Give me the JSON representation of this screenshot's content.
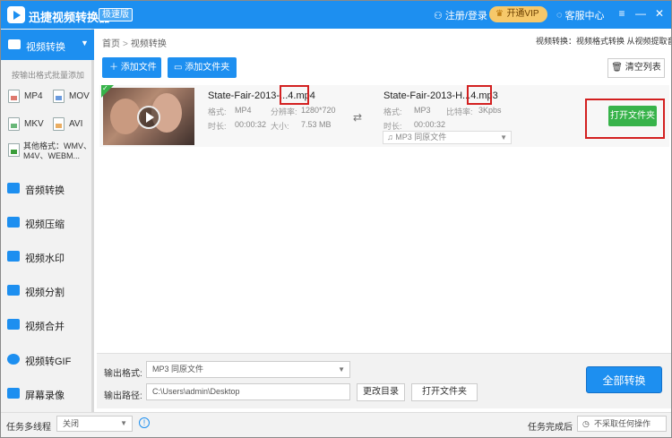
{
  "titlebar": {
    "app_title": "迅捷视频转换器",
    "edition_badge": "极速版",
    "login_label": "注册/登录",
    "vip_label": "开通VIP",
    "service_label": "客服中心"
  },
  "sidebar": {
    "active_item": "视频转换",
    "format_hint": "按输出格式批量添加",
    "formats": [
      "MP4",
      "MOV",
      "MKV",
      "AVI"
    ],
    "other_formats": "其他格式：WMV、M4V、WEBM...",
    "items": [
      "音频转换",
      "视频压缩",
      "视频水印",
      "视频分割",
      "视频合并",
      "视频转GIF",
      "屏幕录像"
    ]
  },
  "breadcrumb": {
    "home": "首页",
    "separator": ">",
    "current": "视频转换"
  },
  "header_hint": "视频转换：视频格式转换 从视频提取音频",
  "toolbar": {
    "add_file": "添加文件",
    "add_folder": "添加文件夹",
    "clear_list": "清空列表"
  },
  "file_row": {
    "source": {
      "name_prefix": "State-Fair-2013-...",
      "name_ext": "4.mp4",
      "format_label": "格式:",
      "format_value": "MP4",
      "resolution_label": "分辨率:",
      "resolution_value": "1280*720",
      "duration_label": "时长:",
      "duration_value": "00:00:32",
      "size_label": "大小:",
      "size_value": "7.53 MB"
    },
    "output": {
      "name_prefix": "State-Fair-2013-H...",
      "name_ext": "4.mp3",
      "format_label": "格式:",
      "format_value": "MP3",
      "bitrate_label": "比特率:",
      "bitrate_value": "3Kpbs",
      "duration_label": "时长:",
      "duration_value": "00:00:32",
      "select_value": "MP3  同原文件"
    },
    "open_folder": "打开文件夹"
  },
  "bottom": {
    "output_format_label": "输出格式:",
    "output_format_value": "MP3  同原文件",
    "output_path_label": "输出路径:",
    "output_path_value": "C:\\Users\\admin\\Desktop",
    "change_dir": "更改目录",
    "open_folder": "打开文件夹",
    "convert_all": "全部转换"
  },
  "statusbar": {
    "multithread_label": "任务多线程",
    "multithread_value": "关闭",
    "after_label": "任务完成后",
    "after_value": "不采取任何操作"
  },
  "colors": {
    "brand": "#1d8ff0",
    "success": "#37b34a",
    "highlight": "#d32020"
  }
}
